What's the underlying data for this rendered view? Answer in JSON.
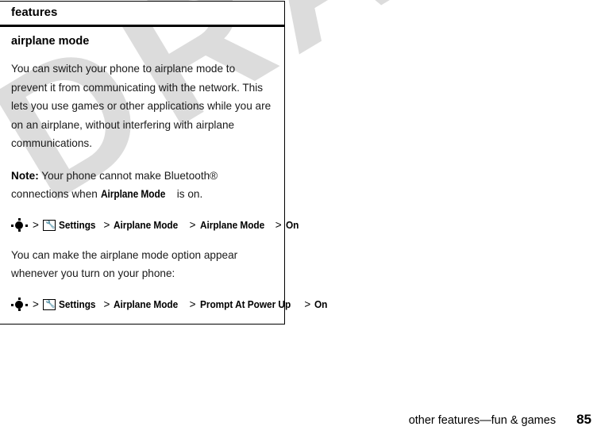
{
  "watermark": {
    "text": "DRAFT",
    "color": "#dcdcdc"
  },
  "chapter_header": {
    "title": "features"
  },
  "section": {
    "title": "airplane mode",
    "paragraph_1": "You can switch your phone to airplane mode to prevent it from communicating with the network. This lets you use games or other applications while you are on an airplane, without interfering with airplane communications.",
    "note": {
      "label": "Note:",
      "text_before": "Your phone cannot make Bluetooth® connections when",
      "menu_term": "Airplane Mode",
      "text_after": "is on."
    },
    "paragraph_2": "You can make the airplane mode option appear whenever you turn on your phone:"
  },
  "nav_paths": [
    {
      "center_key_icon": "center-select-key-icon",
      "separator": ">",
      "settings_icon": "settings-wrench-icon",
      "steps": [
        "Settings",
        "Airplane Mode",
        "Airplane Mode",
        "On"
      ]
    },
    {
      "center_key_icon": "center-select-key-icon",
      "separator": ">",
      "settings_icon": "settings-wrench-icon",
      "steps": [
        "Settings",
        "Airplane Mode",
        "Prompt At Power Up",
        "On"
      ]
    }
  ],
  "footer": {
    "title": "other features—fun & games",
    "page_number": "85"
  }
}
